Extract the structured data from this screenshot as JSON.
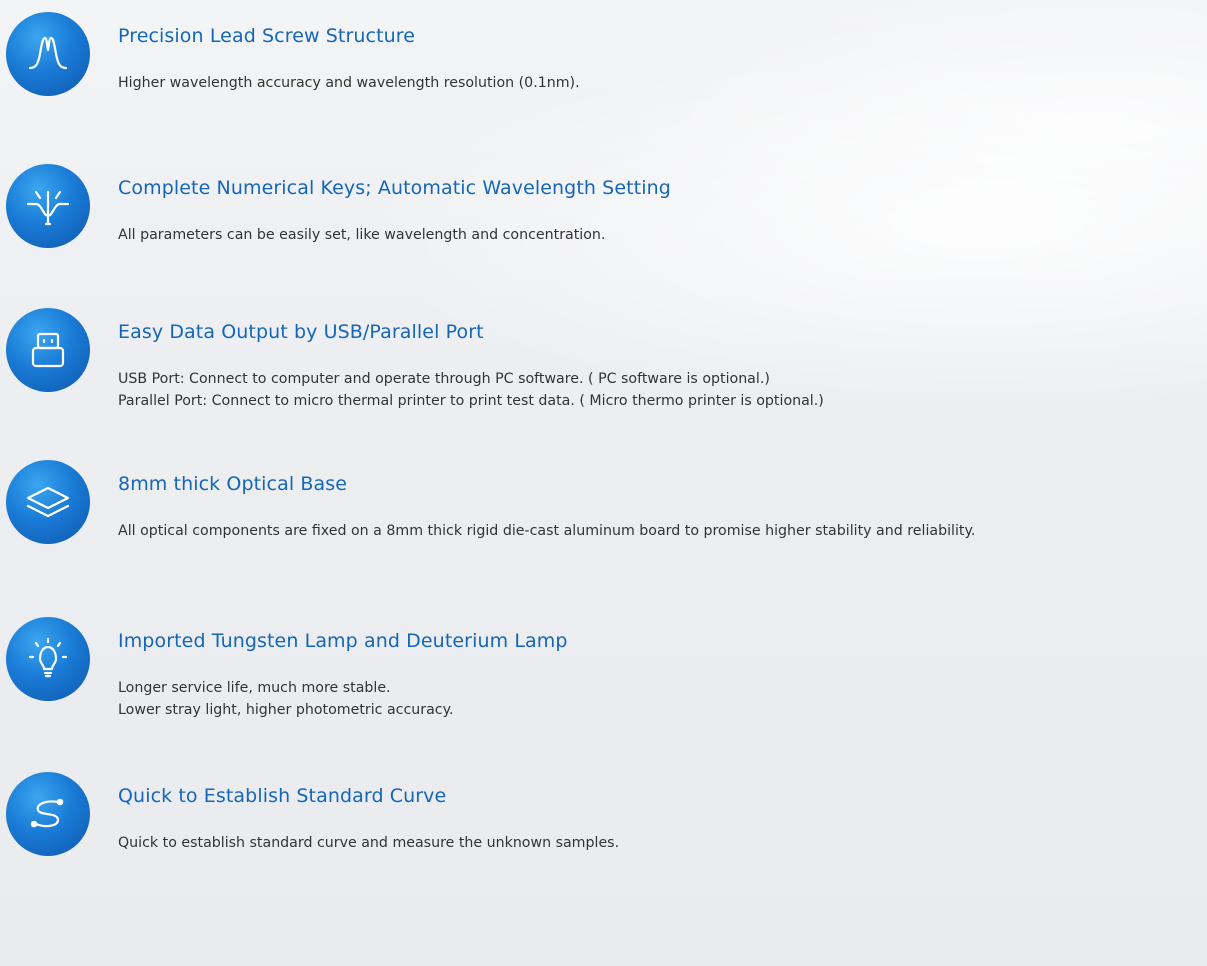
{
  "features": [
    {
      "icon": "peak-curve-icon",
      "title": "Precision Lead Screw Structure",
      "lines": [
        "Higher wavelength accuracy and wavelength resolution (0.1nm)."
      ]
    },
    {
      "icon": "wavelength-setting-icon",
      "title": "Complete Numerical Keys; Automatic Wavelength Setting",
      "lines": [
        "All parameters can be easily set, like wavelength and concentration."
      ]
    },
    {
      "icon": "usb-port-icon",
      "title": "Easy Data Output by USB/Parallel Port",
      "lines": [
        "USB Port: Connect to computer and operate through PC software. ( PC software is optional.)",
        "Parallel Port: Connect to micro thermal printer to print test data. ( Micro thermo printer is optional.)"
      ]
    },
    {
      "icon": "layers-icon",
      "title": "8mm thick Optical Base",
      "lines": [
        "All optical components are fixed on a 8mm thick rigid die-cast aluminum board to promise higher stability and reliability."
      ]
    },
    {
      "icon": "light-bulb-icon",
      "title": "Imported Tungsten Lamp and Deuterium Lamp",
      "lines": [
        "Longer service life, much more stable.",
        "Lower stray light, higher photometric accuracy."
      ]
    },
    {
      "icon": "standard-curve-icon",
      "title": "Quick to Establish Standard Curve",
      "lines": [
        "Quick to establish standard curve and measure the unknown samples."
      ]
    }
  ],
  "colors": {
    "title": "#1566b8",
    "text": "#333333",
    "icon_gradient_light": "#3aa6ef",
    "icon_gradient_dark": "#0e57ad"
  }
}
